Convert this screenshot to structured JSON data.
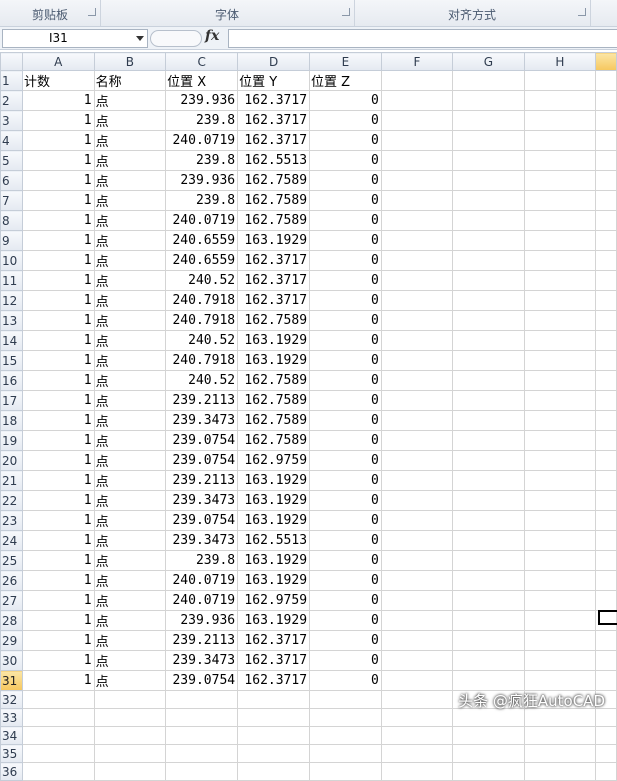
{
  "ribbon": {
    "groups": [
      "剪贴板",
      "字体",
      "对齐方式"
    ]
  },
  "formula_bar": {
    "name_box": "I31",
    "fx_label": "fx",
    "formula": ""
  },
  "columns": [
    "A",
    "B",
    "C",
    "D",
    "E",
    "F",
    "G",
    "H"
  ],
  "headers": [
    "计数",
    "名称",
    "位置 X",
    "位置 Y",
    "位置 Z"
  ],
  "rows": [
    [
      "1",
      "点",
      "239.936",
      "162.3717",
      "0"
    ],
    [
      "1",
      "点",
      "239.8",
      "162.3717",
      "0"
    ],
    [
      "1",
      "点",
      "240.0719",
      "162.3717",
      "0"
    ],
    [
      "1",
      "点",
      "239.8",
      "162.5513",
      "0"
    ],
    [
      "1",
      "点",
      "239.936",
      "162.7589",
      "0"
    ],
    [
      "1",
      "点",
      "239.8",
      "162.7589",
      "0"
    ],
    [
      "1",
      "点",
      "240.0719",
      "162.7589",
      "0"
    ],
    [
      "1",
      "点",
      "240.6559",
      "163.1929",
      "0"
    ],
    [
      "1",
      "点",
      "240.6559",
      "162.3717",
      "0"
    ],
    [
      "1",
      "点",
      "240.52",
      "162.3717",
      "0"
    ],
    [
      "1",
      "点",
      "240.7918",
      "162.3717",
      "0"
    ],
    [
      "1",
      "点",
      "240.7918",
      "162.7589",
      "0"
    ],
    [
      "1",
      "点",
      "240.52",
      "163.1929",
      "0"
    ],
    [
      "1",
      "点",
      "240.7918",
      "163.1929",
      "0"
    ],
    [
      "1",
      "点",
      "240.52",
      "162.7589",
      "0"
    ],
    [
      "1",
      "点",
      "239.2113",
      "162.7589",
      "0"
    ],
    [
      "1",
      "点",
      "239.3473",
      "162.7589",
      "0"
    ],
    [
      "1",
      "点",
      "239.0754",
      "162.7589",
      "0"
    ],
    [
      "1",
      "点",
      "239.0754",
      "162.9759",
      "0"
    ],
    [
      "1",
      "点",
      "239.2113",
      "163.1929",
      "0"
    ],
    [
      "1",
      "点",
      "239.3473",
      "163.1929",
      "0"
    ],
    [
      "1",
      "点",
      "239.0754",
      "163.1929",
      "0"
    ],
    [
      "1",
      "点",
      "239.3473",
      "162.5513",
      "0"
    ],
    [
      "1",
      "点",
      "239.8",
      "163.1929",
      "0"
    ],
    [
      "1",
      "点",
      "240.0719",
      "163.1929",
      "0"
    ],
    [
      "1",
      "点",
      "240.0719",
      "162.9759",
      "0"
    ],
    [
      "1",
      "点",
      "239.936",
      "163.1929",
      "0"
    ],
    [
      "1",
      "点",
      "239.2113",
      "162.3717",
      "0"
    ],
    [
      "1",
      "点",
      "239.3473",
      "162.3717",
      "0"
    ],
    [
      "1",
      "点",
      "239.0754",
      "162.3717",
      "0"
    ]
  ],
  "row_numbers": [
    "1",
    "2",
    "3",
    "4",
    "5",
    "6",
    "7",
    "8",
    "9",
    "10",
    "11",
    "12",
    "13",
    "14",
    "15",
    "16",
    "17",
    "18",
    "19",
    "20",
    "21",
    "22",
    "23",
    "24",
    "25",
    "26",
    "27",
    "28",
    "29",
    "30",
    "31",
    "32",
    "33",
    "34",
    "35",
    "36"
  ],
  "selected_row": "31",
  "watermark": "头条 @疯狂AutoCAD",
  "colors": {
    "header_bg": "#e4e9f1",
    "selected_header": "#f6c75e",
    "gridline": "#d4d4d4"
  }
}
